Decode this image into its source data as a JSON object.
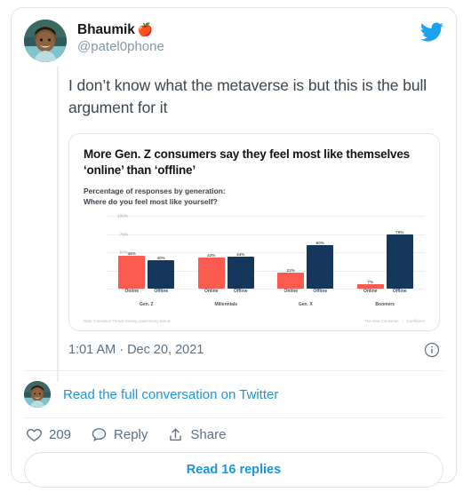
{
  "tweet": {
    "display_name": "Bhaumik",
    "name_emoji": "🍎",
    "handle": "@patel0phone",
    "text": "I don’t know what the metaverse is but this is the bull argument for it",
    "timestamp": "1:01 AM · Dec 20, 2021",
    "conversation_link": "Read the full conversation on Twitter",
    "read_replies": "Read 16 replies"
  },
  "actions": {
    "like_count": "209",
    "reply_label": "Reply",
    "share_label": "Share"
  },
  "chart_data": {
    "type": "bar",
    "title": "More Gen. Z consumers say they feel most like themselves ‘online’ than ‘offline’",
    "subtitle_line1": "Percentage of responses by generation:",
    "subtitle_line2": "Where do you feel most like yourself?",
    "xlabel": "",
    "ylabel": "",
    "ylim": [
      0,
      100
    ],
    "yticks": [
      "0%",
      "25%",
      "50%",
      "75%",
      "100%"
    ],
    "grid": true,
    "legend": "none",
    "categories": [
      "Gen. Z",
      "Millennials",
      "Gen. X",
      "Boomers"
    ],
    "bar_labels": [
      "Online",
      "Offline"
    ],
    "series": [
      {
        "name": "Online",
        "color": "#fb5a4f",
        "values": [
          46,
          43,
          22,
          7
        ]
      },
      {
        "name": "Offline",
        "color": "#15375c",
        "values": [
          40,
          44,
          60,
          75
        ]
      }
    ],
    "value_labels": {
      "gen_z_online": "46%",
      "gen_z_offline": "40%",
      "millennials_online": "43%",
      "millennials_offline": "44%",
      "gen_x_online": "22%",
      "gen_x_offline": "60%",
      "boomers_online": "7%",
      "boomers_offline": "75%"
    },
    "source": "Data: Consumer Trends Survey, powered by bizture",
    "brand_left": "The New Consumer",
    "brand_right": "Coefficient"
  },
  "colors": {
    "twitter_blue": "#1DA1F2",
    "link_blue": "#1b95e0",
    "online_bar": "#fb5a4f",
    "offline_bar": "#15375c"
  }
}
